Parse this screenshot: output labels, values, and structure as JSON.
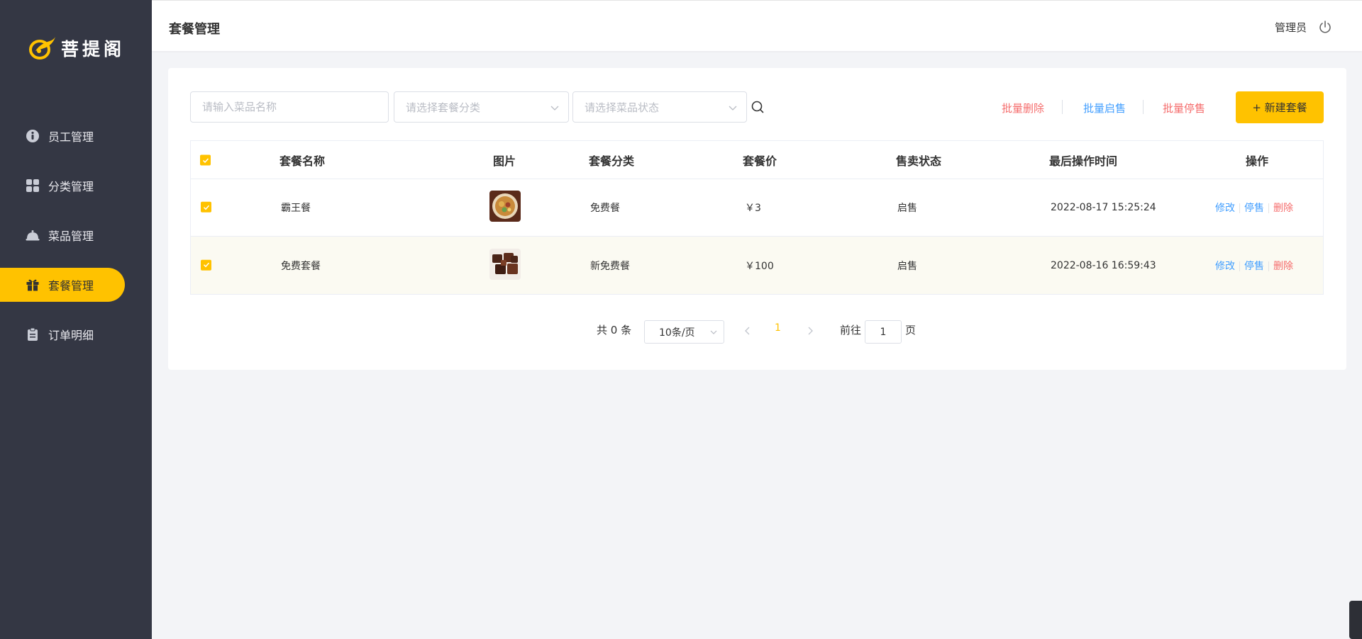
{
  "app": {
    "brand": "菩提阁"
  },
  "sidebar": {
    "items": [
      {
        "label": "员工管理",
        "icon": "employee-icon",
        "active": false
      },
      {
        "label": "分类管理",
        "icon": "category-grid-icon",
        "active": false
      },
      {
        "label": "菜品管理",
        "icon": "dish-cloche-icon",
        "active": false
      },
      {
        "label": "套餐管理",
        "icon": "gift-icon",
        "active": true
      },
      {
        "label": "订单明细",
        "icon": "clipboard-icon",
        "active": false
      }
    ]
  },
  "header": {
    "title": "套餐管理",
    "user": "管理员",
    "logout_icon": "power-icon"
  },
  "toolbar": {
    "name_placeholder": "请输入菜品名称",
    "category_placeholder": "请选择套餐分类",
    "status_placeholder": "请选择菜品状态",
    "batch_delete": "批量删除",
    "batch_enable": "批量启售",
    "batch_disable": "批量停售",
    "new_button": "+ 新建套餐"
  },
  "table": {
    "columns": [
      "套餐名称",
      "图片",
      "套餐分类",
      "套餐价",
      "售卖状态",
      "最后操作时间",
      "操作"
    ],
    "rows": [
      {
        "name": "霸王餐",
        "category": "免费餐",
        "price": "￥3",
        "status": "启售",
        "updated": "2022-08-17 15:25:24",
        "actions": [
          "修改",
          "停售",
          "删除"
        ]
      },
      {
        "name": "免费套餐",
        "category": "新免费餐",
        "price": "￥100",
        "status": "启售",
        "updated": "2022-08-16 16:59:43",
        "actions": [
          "修改",
          "停售",
          "删除"
        ]
      }
    ]
  },
  "pagination": {
    "total": "共 0 条",
    "page_size": "10条/页",
    "current_page": "1",
    "goto_label": "前往",
    "goto_value": "1",
    "page_suffix": "页"
  },
  "colors": {
    "accent": "#ffc200",
    "sidebar": "#343744",
    "link_blue": "#419eff",
    "link_red": "#f56c6c"
  }
}
